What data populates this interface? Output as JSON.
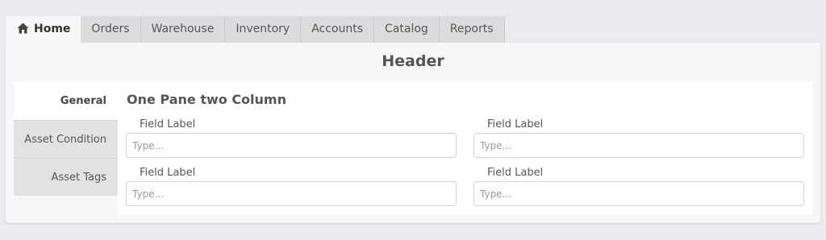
{
  "tabs": [
    {
      "label": "Home",
      "icon": "home-icon",
      "active": true
    },
    {
      "label": "Orders"
    },
    {
      "label": "Warehouse"
    },
    {
      "label": "Inventory"
    },
    {
      "label": "Accounts"
    },
    {
      "label": "Catalog"
    },
    {
      "label": "Reports"
    }
  ],
  "panel": {
    "title": "Header",
    "side_tabs": [
      {
        "label": "General",
        "active": true
      },
      {
        "label": "Asset Condition"
      },
      {
        "label": "Asset Tags"
      }
    ],
    "section_title": "One Pane two Column",
    "fields": [
      {
        "label": "Field Label",
        "placeholder": "Type..."
      },
      {
        "label": "Field Label",
        "placeholder": "Type..."
      },
      {
        "label": "Field Label",
        "placeholder": "Type..."
      },
      {
        "label": "Field Label",
        "placeholder": "Type..."
      }
    ]
  },
  "colors": {
    "background": "#ebebef",
    "tab_inactive": "#dcdcdc",
    "panel": "#f7f7f7",
    "content": "#ffffff"
  }
}
